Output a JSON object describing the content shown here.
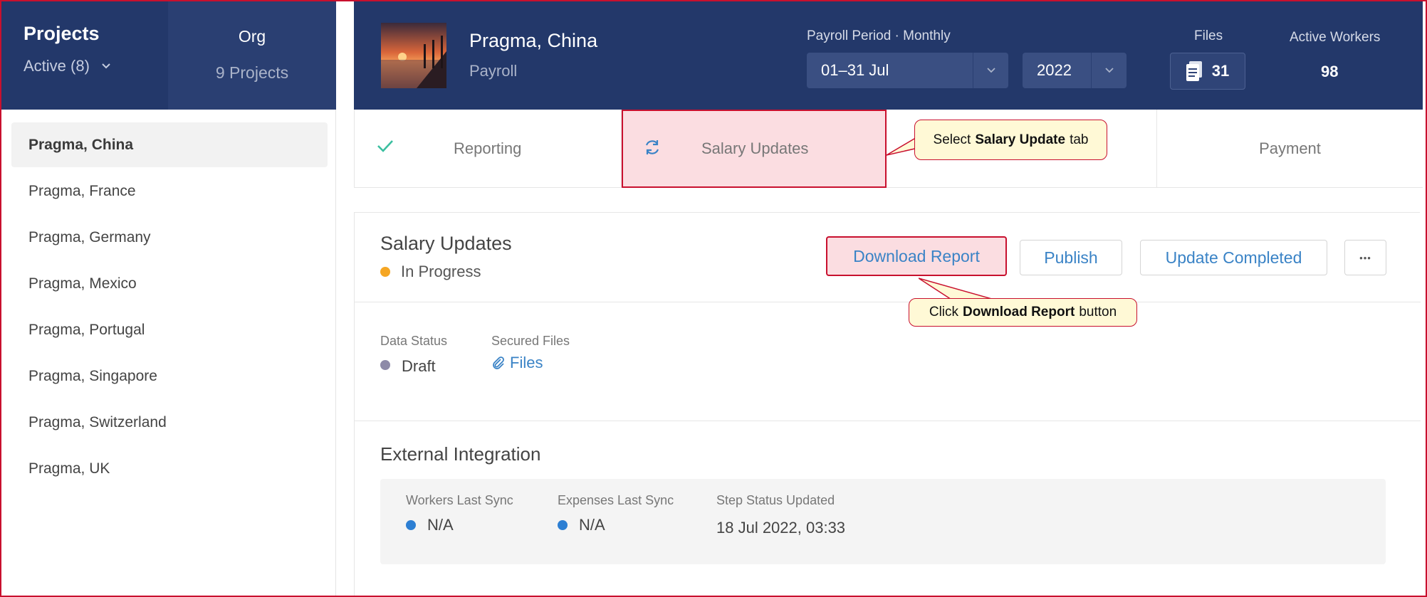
{
  "sidebar": {
    "title": "Projects",
    "filter": "Active (8)",
    "org_label": "Org",
    "org_count": "9 Projects",
    "items": [
      {
        "label": "Pragma, China"
      },
      {
        "label": "Pragma, France"
      },
      {
        "label": "Pragma, Germany"
      },
      {
        "label": "Pragma, Mexico"
      },
      {
        "label": "Pragma, Portugal"
      },
      {
        "label": "Pragma, Singapore"
      },
      {
        "label": "Pragma, Switzerland"
      },
      {
        "label": "Pragma, UK"
      }
    ]
  },
  "header": {
    "project_name": "Pragma, China",
    "project_sub": "Payroll",
    "period_label": "Payroll Period · Monthly",
    "period_value": "01–31 Jul",
    "year_value": "2022",
    "files_label": "Files",
    "files_count": "31",
    "active_workers_label": "Active Workers",
    "active_workers_value": "98"
  },
  "steps": {
    "reporting": "Reporting",
    "salary_updates": "Salary Updates",
    "payment": "Payment"
  },
  "main": {
    "title": "Salary Updates",
    "status": "In Progress",
    "buttons": {
      "download": "Download Report",
      "publish": "Publish",
      "update_completed": "Update Completed",
      "more": "•••"
    },
    "data_status_label": "Data Status",
    "data_status_value": "Draft",
    "secured_files_label": "Secured Files",
    "secured_files_link": "Files",
    "external": {
      "title": "External Integration",
      "workers_label": "Workers Last Sync",
      "workers_value": "N/A",
      "expenses_label": "Expenses Last Sync",
      "expenses_value": "N/A",
      "step_label": "Step Status Updated",
      "step_value": "18 Jul 2022, 03:33"
    }
  },
  "callouts": {
    "salary": {
      "pre": "Select",
      "bold": "Salary Update",
      "post": "tab"
    },
    "download": {
      "pre": "Click",
      "bold": "Download Report",
      "post": "button"
    }
  },
  "colors": {
    "navy": "#23386a",
    "accent_blue": "#3a83c6",
    "highlight_red": "#c8102e",
    "status_orange": "#f5a623",
    "status_gray": "#8e8aa8",
    "sync_blue": "#2d7fd3"
  }
}
